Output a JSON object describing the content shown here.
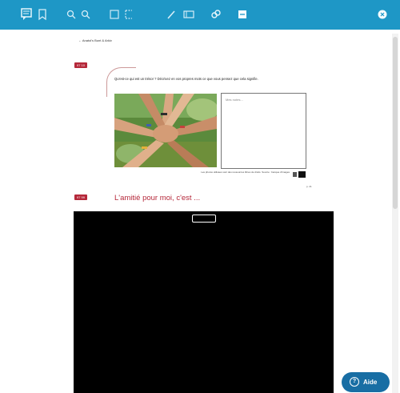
{
  "toolbar": {
    "icons": [
      "notes-icon",
      "bookmark-icon",
      "zoom-in-icon",
      "zoom-out-icon",
      "fullscreen-icon",
      "selection-icon",
      "pen-icon",
      "eraser-icon",
      "link-icon",
      "page-icon",
      "close-icon"
    ],
    "color": "#1e97c6"
  },
  "page": {
    "breadcrumb": "Anatol's Bunt & Arkiv",
    "tag_top": "97 10",
    "instruction": "Qu'est-ce qui est un trésor ? Décrivez en vos propres mots ce que vous pensez que cela signifie.",
    "note_placeholder": "Mes notes...",
    "credits": "Les photos utilisées sont des ressources libres de droits. Source : banque d'images",
    "page_number": "p. 21",
    "tag_bottom": "97 99",
    "section_title": "L'amitié pour moi, c'est ..."
  },
  "help_button": {
    "label": "Aide",
    "icon": "question-icon"
  },
  "colors": {
    "accent": "#b5283a",
    "toolbar": "#1e97c6",
    "help": "#186ea4"
  }
}
